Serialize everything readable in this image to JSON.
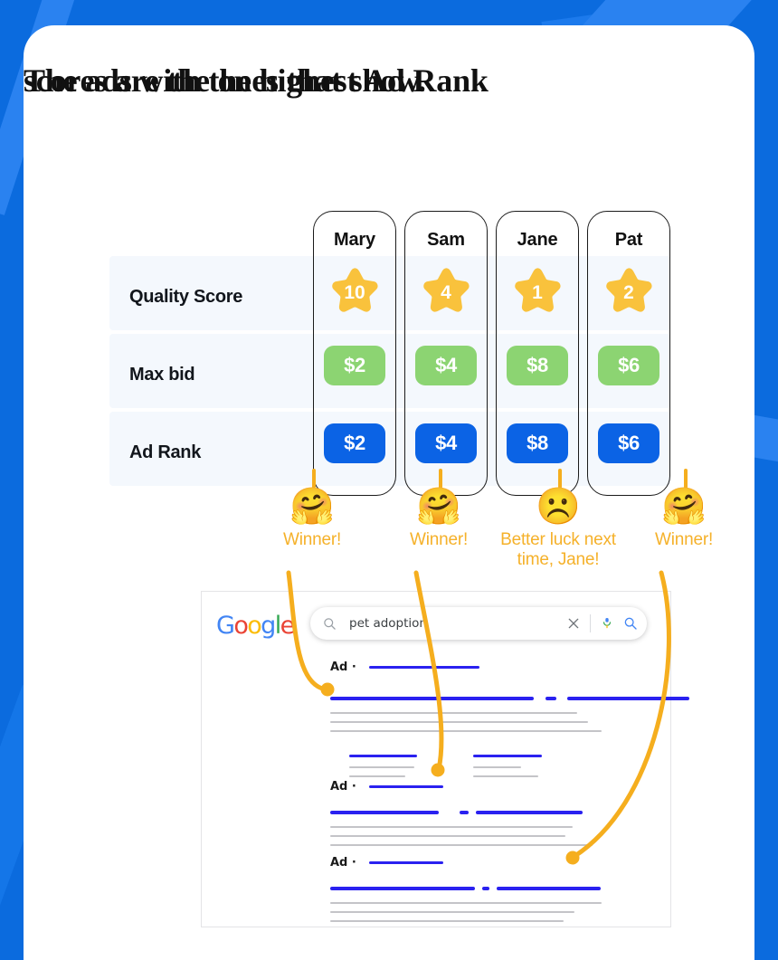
{
  "title": {
    "line1": "The ads with the highest Ad Rank",
    "line2": "scores are the ones that show."
  },
  "colors": {
    "page_background": "#0B6BDE",
    "card_background": "#FFFFFF",
    "row_band": "#F4F8FD",
    "star": "#F9C23C",
    "max_bid_pill": "#8CD472",
    "ad_rank_pill": "#0B63E5",
    "accent_orange": "#F5B12A",
    "serp_link_blue": "#2A21F0"
  },
  "table": {
    "row_labels": [
      "Quality Score",
      "Max bid",
      "Ad Rank"
    ],
    "columns": [
      {
        "name": "Mary",
        "quality_score": "10",
        "max_bid": "$2",
        "ad_rank": "$2",
        "outcome": "Winner!",
        "emoji": "hugging-face-emoji",
        "emoji_glyph": "🤗"
      },
      {
        "name": "Sam",
        "quality_score": "4",
        "max_bid": "$4",
        "ad_rank": "$4",
        "outcome": "Winner!",
        "emoji": "hugging-face-emoji",
        "emoji_glyph": "🤗"
      },
      {
        "name": "Jane",
        "quality_score": "1",
        "max_bid": "$8",
        "ad_rank": "$8",
        "outcome": "Better luck next time, Jane!",
        "emoji": "frowning-face-emoji",
        "emoji_glyph": "☹️"
      },
      {
        "name": "Pat",
        "quality_score": "2",
        "max_bid": "$6",
        "ad_rank": "$6",
        "outcome": "Winner!",
        "emoji": "hugging-face-emoji",
        "emoji_glyph": "🤗"
      }
    ]
  },
  "serp": {
    "logo_letters": [
      "G",
      "o",
      "o",
      "g",
      "l",
      "e"
    ],
    "search_value": "pet adoption",
    "search_icon": "search-icon",
    "clear_icon": "close-icon",
    "mic_icon": "microphone-icon",
    "submit_icon": "search-icon",
    "ads": [
      {
        "label": "Ad ·"
      },
      {
        "label": "Ad ·"
      },
      {
        "label": "Ad ·"
      }
    ]
  },
  "chart_data": {
    "type": "table",
    "title": "The ads with the highest Ad Rank scores are the ones that show.",
    "categories": [
      "Mary",
      "Sam",
      "Jane",
      "Pat"
    ],
    "series": [
      {
        "name": "Quality Score",
        "values": [
          10,
          4,
          1,
          2
        ]
      },
      {
        "name": "Max bid",
        "values": [
          2,
          4,
          8,
          6
        ]
      },
      {
        "name": "Ad Rank",
        "values": [
          2,
          4,
          8,
          6
        ]
      }
    ],
    "annotations": [
      "Winner!",
      "Winner!",
      "Better luck next time, Jane!",
      "Winner!"
    ],
    "xlabel": "",
    "ylabel": "",
    "legend": "none"
  }
}
